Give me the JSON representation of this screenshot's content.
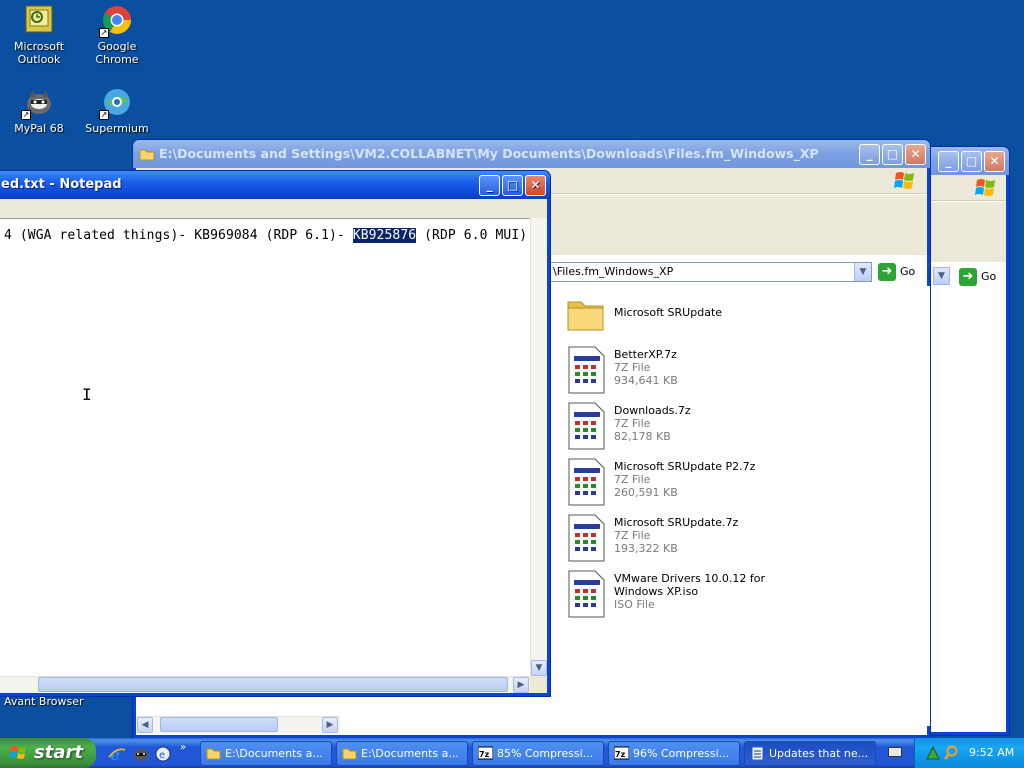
{
  "desktop": {
    "icons": [
      {
        "label": "Microsoft Outlook"
      },
      {
        "label": "Google Chrome"
      },
      {
        "label": "MyPal 68"
      },
      {
        "label": "Supermium"
      }
    ],
    "partial_icon_label": "Avant Browser"
  },
  "explorer": {
    "title": "E:\\Documents and Settings\\VM2.COLLABNET\\My Documents\\Downloads\\Files.fm_Windows_XP",
    "address_value": "\\Files.fm_Windows_XP",
    "go_label": "Go",
    "files": [
      {
        "name": "Microsoft SRUpdate",
        "type": "",
        "size": "",
        "icon": "folder-icon"
      },
      {
        "name": "BetterXP.7z",
        "type": "7Z File",
        "size": "934,641 KB",
        "icon": "7z-file-icon"
      },
      {
        "name": "Downloads.7z",
        "type": "7Z File",
        "size": "82,178 KB",
        "icon": "7z-file-icon"
      },
      {
        "name": "Microsoft SRUpdate P2.7z",
        "type": "7Z File",
        "size": "260,591 KB",
        "icon": "7z-file-icon"
      },
      {
        "name": "Microsoft SRUpdate.7z",
        "type": "7Z File",
        "size": "193,322 KB",
        "icon": "7z-file-icon"
      },
      {
        "name": "VMware Drivers 10.0.12 for Windows XP.iso",
        "type": "ISO File",
        "size": "",
        "icon": "iso-file-icon"
      }
    ]
  },
  "explorer2": {
    "go_label": "Go"
  },
  "notepad": {
    "title": "ed.txt - Notepad",
    "text_before": "4 (WGA related things)- KB969084 (RDP 6.1)- ",
    "text_selected": "KB925876",
    "text_after": " (RDP 6.0 MUI)"
  },
  "taskbar": {
    "start_label": "start",
    "tasks": [
      {
        "label": "E:\\Documents a...",
        "icon": "folder-icon"
      },
      {
        "label": "E:\\Documents a...",
        "icon": "folder-icon"
      },
      {
        "label": "85% Compressi...",
        "icon": "7zip-icon"
      },
      {
        "label": "96% Compressi...",
        "icon": "7zip-icon"
      },
      {
        "label": "Updates that ne...",
        "icon": "notepad-icon"
      }
    ],
    "clock": "9:52 AM"
  },
  "colors": {
    "desktop": "#0a4fa0",
    "selection": "#0a246a",
    "start_green": "#3a913a"
  }
}
